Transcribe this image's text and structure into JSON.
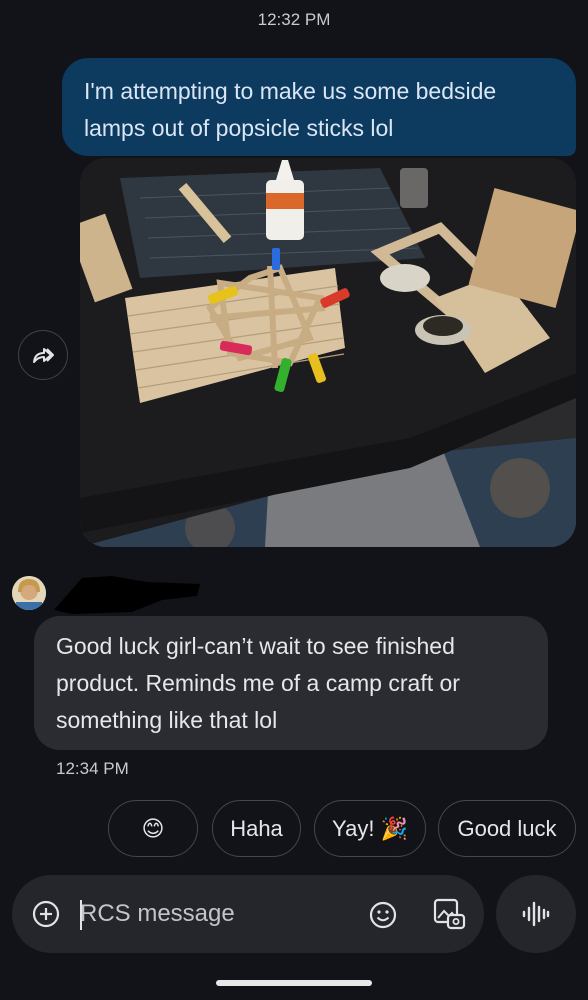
{
  "conversation": {
    "timestamp_top": "12:32 PM",
    "outgoing_message": "I'm attempting to make us some bedside lamps out of popsicle sticks lol",
    "incoming_message": "Good luck girl-can’t wait to see finished product. Reminds me of a camp craft or something like that lol",
    "timestamp_incoming": "12:34 PM"
  },
  "smart_replies": {
    "emoji": "😊",
    "haha": "Haha",
    "yay": "Yay! 🎉",
    "good_luck": "Good luck"
  },
  "composer": {
    "placeholder": "RCS message"
  },
  "colors": {
    "background": "#111318",
    "outgoing_bubble": "#0d3a5f",
    "incoming_bubble": "#2a2c31"
  },
  "icons": [
    "forward-icon",
    "add-icon",
    "emoji-icon",
    "gallery-icon",
    "voice-icon"
  ]
}
